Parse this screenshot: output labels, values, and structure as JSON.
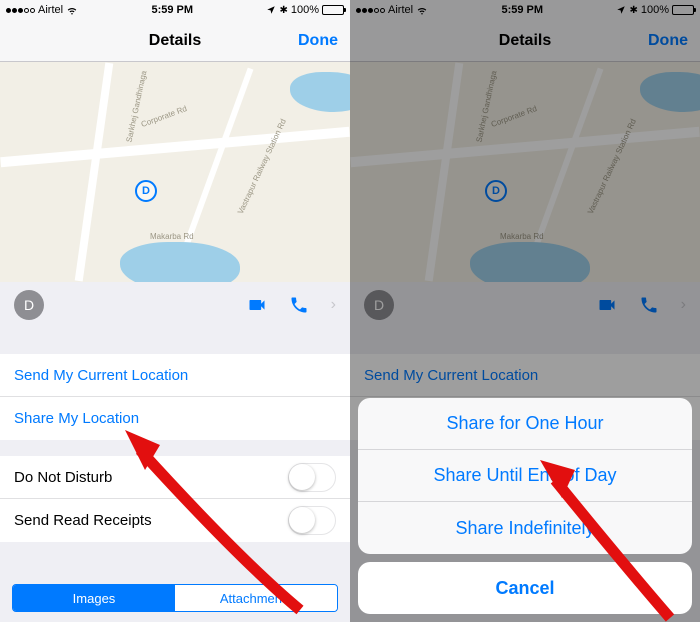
{
  "statusbar": {
    "signal_filled": 3,
    "carrier": "Airtel",
    "time": "5:59 PM",
    "battery_pct": "100%"
  },
  "nav": {
    "title": "Details",
    "done": "Done"
  },
  "map": {
    "pin_letter": "D",
    "roads": [
      "Sarkhej Gandhinaga",
      "Corporate Rd",
      "Vastrapur Railway Station Rd",
      "Makarba Rd"
    ]
  },
  "contact": {
    "avatar_letter": "D"
  },
  "location_actions": {
    "send_current": "Send My Current Location",
    "share": "Share My Location"
  },
  "toggles": {
    "dnd": "Do Not Disturb",
    "read_receipts": "Send Read Receipts"
  },
  "segments": {
    "images": "Images",
    "attachments": "Attachments"
  },
  "share_sheet": {
    "one_hour": "Share for One Hour",
    "end_of_day": "Share Until End of Day",
    "indefinitely": "Share Indefinitely",
    "cancel": "Cancel"
  }
}
